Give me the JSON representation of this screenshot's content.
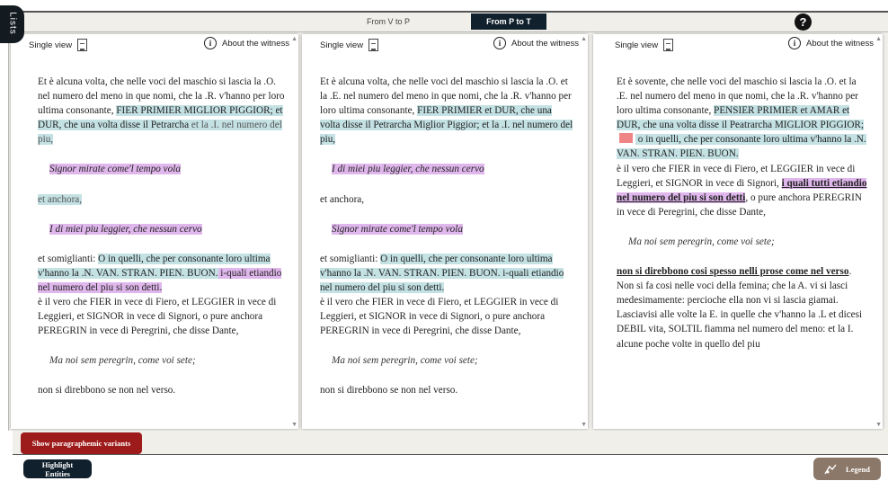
{
  "lists_label": "Lists",
  "tabs": {
    "v_to_p": "From V to P",
    "p_to_t": "From P to T"
  },
  "help_glyph": "?",
  "panel_header": {
    "single_view": "Single view",
    "about": "About the witness"
  },
  "panels": [
    {
      "p1": [
        "Et è alcuna volta, che nelle voci del maschio si lascia la .O. nel numero del meno in que nomi, che la .R. v'hanno per loro ultima consonante, ",
        "FIER PRIMIER MIGLIOR PIGGIOR; et DUR, che una volta disse il Petrarcha",
        " et la .I. nel numero del piu,"
      ],
      "v1": "Signor mirate come'l tempo vola",
      "mid": "et anchora,",
      "v2": "I di miei piu leggier, che nessun cervo",
      "p2": [
        "et somiglianti: ",
        "O in quelli, che per consonante loro ultima v'hanno la .N. VAN. STRAN. PIEN. BUON.",
        " i-quali etiandio nel numero del piu si son detti."
      ],
      "p3": "è il vero che FIER in vece di Fiero, et LEGGIER in vece di Leggieri, et SIGNOR in vece di Signori, o pure anchora PEREGRIN in vece di Peregrini, che disse Dante,",
      "v3": "Ma noi sem peregrin, come voi sete;",
      "end": "non si direbbono se non nel verso."
    },
    {
      "p1": [
        "Et è alcuna volta, che nelle voci del maschio si lascia la .O. et la .E. nel numero del meno in que nomi, che la .R. v'hanno per loro ultima consonante, ",
        "FIER PRIMIER et DUR, che una volta disse il Petrarcha Miglior Piggior; et la .I. nel numero del piu,"
      ],
      "v1": "I di miei piu leggier, che nessun cervo",
      "mid": "et anchora,",
      "v2": "Signor mirate come'l tempo vola",
      "p2": [
        "et somiglianti: ",
        "O in quelli, che per consonante loro ultima v'hanno la .N. VAN. STRAN. PIEN. BUON. i-quali etiandio nel numero del piu si son detti."
      ],
      "p3": "è il vero che FIER in vece di Fiero, et LEGGIER in vece di Leggieri, et SIGNOR in vece di Signori, o pure anchora PEREGRIN in vece di Peregrini, che disse Dante,",
      "v3": "Ma noi sem peregrin, come voi sete;",
      "end": "non si direbbono se non nel verso."
    },
    {
      "p1": [
        "Et è sovente, che nelle voci del maschio si lascia la .O. et la .E. nel numero del meno in que nomi, che la .R. v'hanno per loro ultima consonante, ",
        "PENSIER PRIMIER et AMAR et DUR, che una volta disse il Peatrarcha MIGLIOR PIGGIOR;",
        " o in quelli, che per consonante loro ultima v'hanno la .N. VAN. STRAN. PIEN. BUON."
      ],
      "p2": [
        "è il vero che FIER in vece di Fiero, et LEGGIER in vece di Leggieri, et SIGNOR in vece di Signori, ",
        "i quali tutti etiandio nel numero del piu si son detti",
        ", o pure anchora PEREGRIN in vece di Peregrini, che disse Dante,"
      ],
      "v1": "Ma noi sem peregrin, come voi sete;",
      "p3": [
        "non si direbbono cosi spesso nelli prose come nel verso",
        "."
      ],
      "p4": "Non si fa cosi nelle voci della femina; che la A. vi si lasci medesimamente: percioche ella non vi si lascia giamai. Lasciavisi alle volte la E. in quelle che v'hanno la .L et dicesi DEBIL vita, SOLTIL fiamma nel numero del meno: et la I. alcune poche volte in quello del piu"
    }
  ],
  "buttons": {
    "paragraphemic": "Show paragraphemic variants",
    "entities": "Highlight Entities",
    "legend": "Legend"
  },
  "colors": {
    "dark": "#10202c",
    "red_button": "#9e1b1b",
    "legend": "#8c7868",
    "blue_hl": "#c4e1e4",
    "purple_hl": "#e0b7ec"
  }
}
